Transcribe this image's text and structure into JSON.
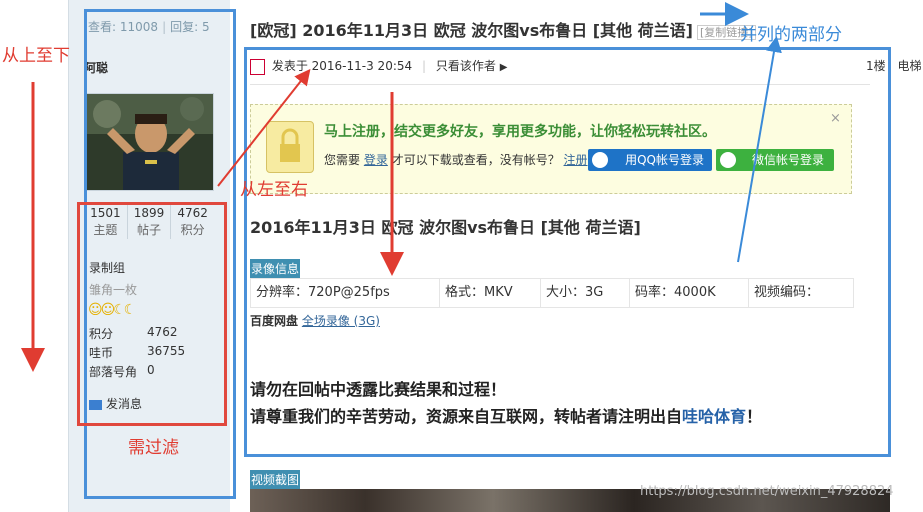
{
  "annotations": {
    "top_to_bottom": "从上至下",
    "left_to_right": "从左至右",
    "two_parallel_parts": "并列的两部分",
    "needs_filter": "需过滤"
  },
  "sidebar": {
    "views_label": "查看:",
    "views": "11008",
    "replies_label": "回复:",
    "replies": "5",
    "author": "阿聪",
    "stats": [
      {
        "value": "1501",
        "label": "主题"
      },
      {
        "value": "1899",
        "label": "帖子"
      },
      {
        "value": "4762",
        "label": "积分"
      }
    ],
    "group": "录制组",
    "title": "雏角一枚",
    "fields": [
      {
        "label": "积分",
        "value": "4762"
      },
      {
        "label": "哇币",
        "value": "36755"
      },
      {
        "label": "部落号角",
        "value": "0"
      }
    ],
    "send_message": "发消息"
  },
  "post": {
    "title": "[欧冠] 2016年11月3日 欧冠 波尔图vs布鲁日 [其他 荷兰语]",
    "copy_link": "[复制链接]",
    "posted_at": "发表于 2016-11-3 20:54",
    "only_author": "只看该作者",
    "floor": "1楼",
    "floor_extra": "电梯",
    "register": {
      "headline": "马上注册，结交更多好友，享用更多功能，让你轻松玩转社区。",
      "line_prefix": "您需要",
      "login_link": "登录",
      "line_mid": "才可以下载或查看，没有帐号？",
      "register_link": "注册",
      "qq_button": "用QQ帐号登录",
      "wechat_button": "微信帐号登录",
      "close": "×"
    },
    "heading": "2016年11月3日 欧冠 波尔图vs布鲁日 [其他 荷兰语]",
    "video_info_tag": "录像信息",
    "video_info": [
      "分辨率：720P@25fps",
      "格式：MKV",
      "大小：3G",
      "码率：4000K",
      "视频编码："
    ],
    "baidu_label": "百度网盘",
    "baidu_link": "全场录像 (3G)",
    "warning_line1": "请勿在回帖中透露比赛结果和过程！",
    "warning_line2_prefix": "请尊重我们的辛苦劳动，资源来自互联网，转帖者请注明出自",
    "warning_line2_highlight": "哇哈体育",
    "warning_line2_suffix": "！",
    "screenshot_tag": "视频截图"
  },
  "watermark": "https://blog.csdn.net/weixin_47928824",
  "colors": {
    "annotation_red": "#e03c31",
    "annotation_blue": "#3a8ad8",
    "register_green": "#3b8e36",
    "qq_blue": "#1e73c7",
    "wechat_green": "#3db13f",
    "tag_bg": "#3f8fb1"
  }
}
